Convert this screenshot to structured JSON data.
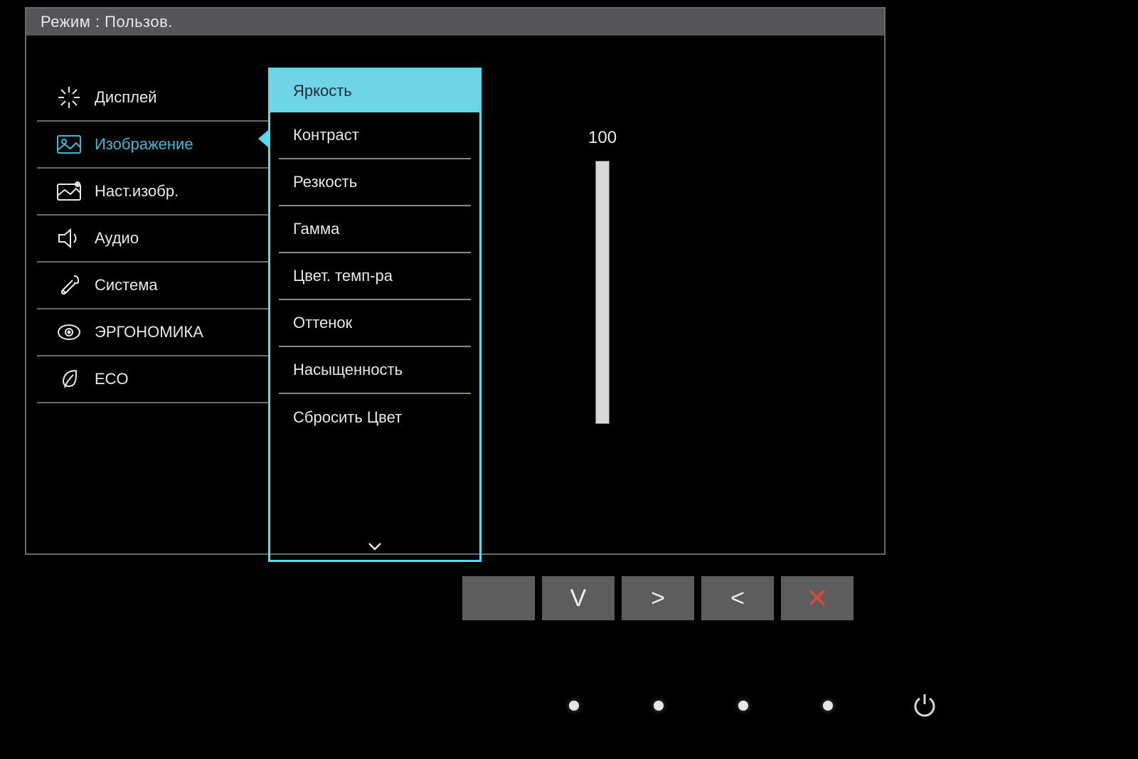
{
  "header": {
    "mode_label": "Режим : Пользов."
  },
  "sidebar": {
    "items": [
      {
        "label": "Дисплей",
        "icon": "display-icon"
      },
      {
        "label": "Изображение",
        "icon": "picture-icon",
        "active": true
      },
      {
        "label": "Наст.изобр.",
        "icon": "picture-adv-icon"
      },
      {
        "label": "Аудио",
        "icon": "audio-icon"
      },
      {
        "label": "Система",
        "icon": "system-icon"
      },
      {
        "label": "ЭРГОНОМИКА",
        "icon": "ergo-icon"
      },
      {
        "label": "ECO",
        "icon": "eco-icon"
      }
    ]
  },
  "submenu": {
    "items": [
      {
        "label": "Яркость",
        "selected": true
      },
      {
        "label": "Контраст"
      },
      {
        "label": "Резкость"
      },
      {
        "label": "Гамма"
      },
      {
        "label": "Цвет. темп-ра"
      },
      {
        "label": "Оттенок"
      },
      {
        "label": "Насыщенность"
      },
      {
        "label": "Сбросить Цвет"
      }
    ],
    "more_below": true
  },
  "value": {
    "current": "100",
    "max": 100,
    "fill_percent": 100
  },
  "buttons": {
    "b1": "",
    "b2": "V",
    "b3": ">",
    "b4": "<",
    "b5": "✕"
  },
  "colors": {
    "accent": "#58d9ec",
    "highlight_bg": "#6ed5e6"
  }
}
